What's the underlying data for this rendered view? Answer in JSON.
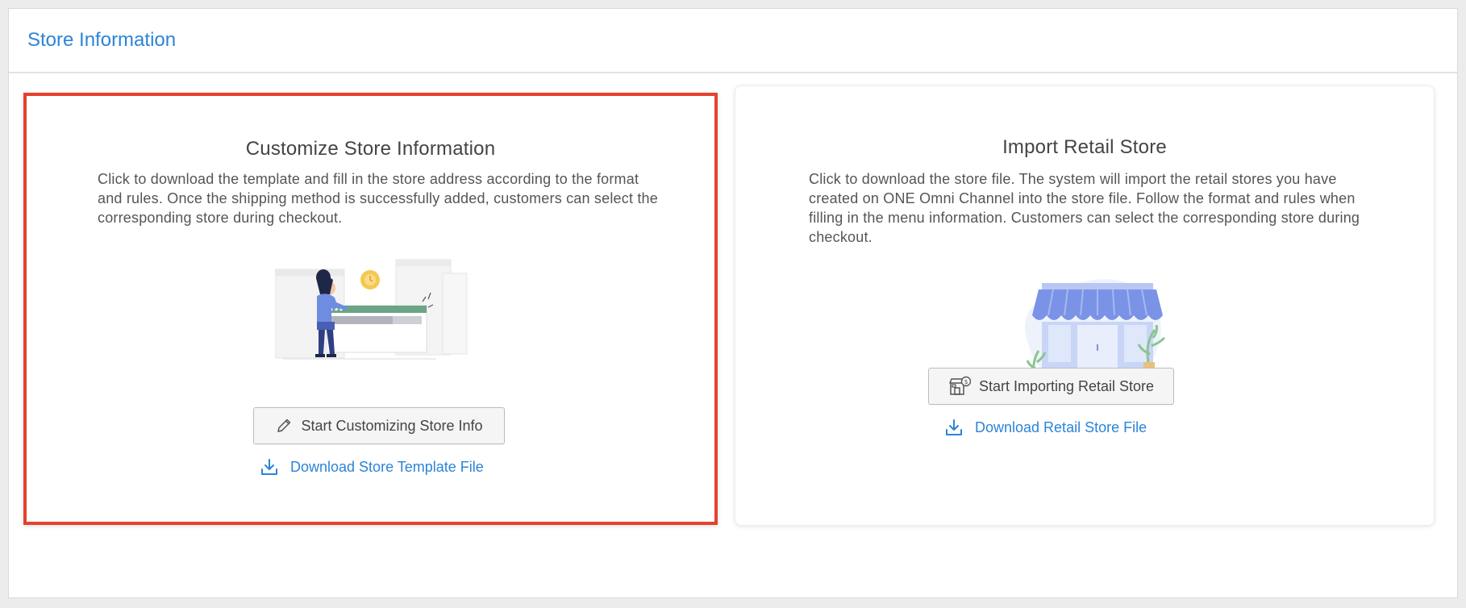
{
  "header": {
    "title": "Store Information"
  },
  "cards": {
    "customize": {
      "title": "Customize Store Information",
      "description": "Click to download the template and fill in the store address according to the format and rules. Once the shipping method is successfully added, customers can select the corresponding store during checkout.",
      "button_label": "Start Customizing Store Info",
      "button_icon": "pencil-icon",
      "link_label": "Download Store Template File",
      "link_icon": "download-icon"
    },
    "import": {
      "title": "Import Retail Store",
      "description": "Click to download the store file. The system will import the retail stores you have created on ONE Omni Channel into the store file. Follow the format and rules when filling in the menu information. Customers can select the corresponding store during checkout.",
      "button_label": "Start Importing Retail Store",
      "button_icon": "store-import-icon",
      "link_label": "Download Retail Store File",
      "link_icon": "download-icon"
    }
  },
  "colors": {
    "accent": "#2b84d7",
    "highlight_border": "#e5412d",
    "illustration_blue": "#7b93e6"
  }
}
